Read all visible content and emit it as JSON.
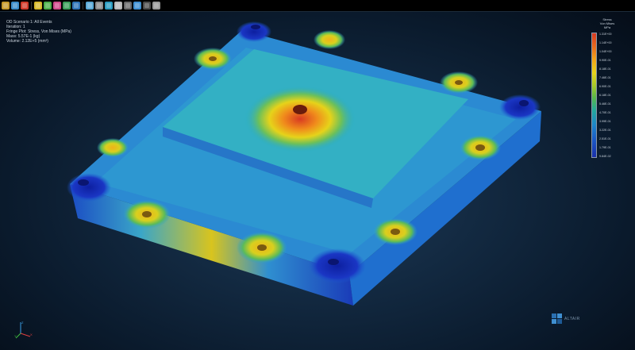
{
  "toolbar": {
    "icons": [
      "open-file-icon",
      "save-icon",
      "import-icon",
      "cube-view-icon",
      "wireframe-icon",
      "mesh-icon",
      "rotate-icon",
      "pan-icon",
      "zoom-icon",
      "fit-view-icon",
      "select-icon",
      "measure-icon",
      "section-icon",
      "probe-icon",
      "animate-icon",
      "settings-icon"
    ]
  },
  "info": {
    "line1": "OD Scenario 1: All Events",
    "line2": "Iteration: 1",
    "line3": "Fringe Plot: Stress, Von Mises (MPa)",
    "line4": "Mass: 5.57E-1 (kg)",
    "line5": "Volume: 2.12E+5 (mm³)"
  },
  "legend": {
    "title1": "Stress",
    "title2": "Von Mises",
    "title3": "MPa",
    "ticks": [
      "1.31E+00",
      "1.14E+00",
      "1.04E+00",
      "9.90E-01",
      "8.18E-01",
      "7.46E-01",
      "6.90E-01",
      "6.18E-01",
      "5.46E-01",
      "4.70E-01",
      "3.99E-01",
      "3.22E-01",
      "2.51E-01",
      "1.79E-01",
      "9.84E-02"
    ],
    "colors": [
      "#d83a22",
      "#e8711d",
      "#f2a818",
      "#e6d31a",
      "#a8c828",
      "#57b64a",
      "#23a99a",
      "#1d86c9",
      "#1b58c4",
      "#1a2fa8"
    ]
  },
  "logo": {
    "text": "ALTAIR"
  },
  "triad": {
    "x": "X",
    "y": "Y",
    "z": "Z"
  }
}
